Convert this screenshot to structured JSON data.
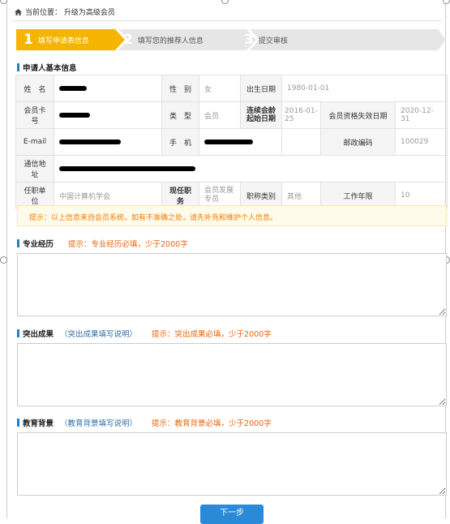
{
  "breadcrumb": {
    "label": "当前位置：",
    "current": "升级为高级会员"
  },
  "steps": [
    {
      "num": "1",
      "label": "填写申请表信息",
      "active": true
    },
    {
      "num": "2",
      "label": "填写您的推荐人信息",
      "active": false
    },
    {
      "num": "3",
      "label": "提交审核",
      "active": false
    }
  ],
  "basic": {
    "title": "申请人基本信息",
    "name_label": "姓　名",
    "gender_label": "性　别",
    "gender_value": "女",
    "birth_label": "出生日期",
    "birth_value": "1980-01-01",
    "card_label": "会员卡号",
    "type_label": "类　型",
    "type_value": "会员",
    "cont_start_label": "连续会龄起始日期",
    "cont_start_value": "2016-01-25",
    "expire_label": "会员资格失效日期",
    "expire_value": "2020-12-31",
    "email_label": "E-mail",
    "phone_label": "手　机",
    "zip_label": "邮政编码",
    "zip_value": "100029",
    "address_label": "通信地址",
    "org_label": "任职单位",
    "org_value": "中国计算机学会",
    "position_label": "现任职务",
    "position_value": "会员发展专员",
    "title_label": "职称类别",
    "title_value": "其他",
    "years_label": "工作年限",
    "years_value": "10"
  },
  "tip": "提示：以上信息来自会员系统，如有不准确之处，请先补充和维护个人信息。",
  "experience": {
    "title": "专业经历",
    "hint": "提示：专业经历必填，少于2000字",
    "value": ""
  },
  "achievements": {
    "title": "突出成果",
    "link": "（突出成果填写说明）",
    "hint": "提示：突出成果必填，少于2000字",
    "value": ""
  },
  "education": {
    "title": "教育背景",
    "link": "（教育背景填写说明）",
    "hint": "提示：教育背景必填，少于2000字",
    "value": ""
  },
  "next_button": "下一步",
  "colors": {
    "accent": "#f5b400",
    "primary": "#2a8ad8",
    "hint": "#e8630a"
  }
}
